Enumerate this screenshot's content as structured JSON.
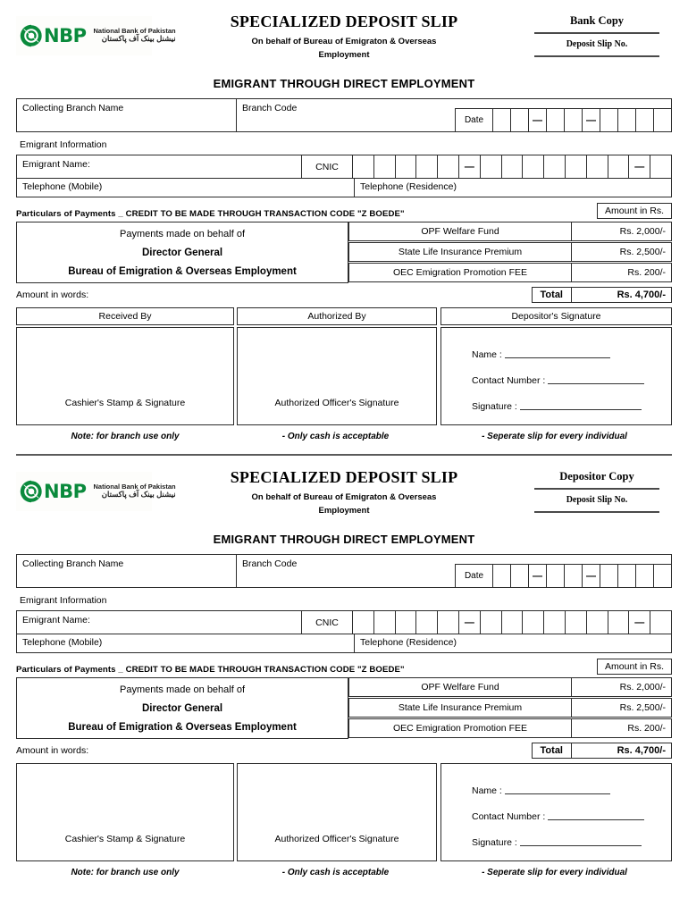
{
  "bank": {
    "logo_icon": "nbp-circular-logo-icon",
    "brand_short": "NBP",
    "name_en": "National Bank of Pakistan",
    "name_ur": "نیشنل بینک آف پاکستان",
    "brand_color": "#0a8a3c"
  },
  "title": "SPECIALIZED DEPOSIT SLIP",
  "subtitle_line1": "On behalf of Bureau of Emigraton  & Overseas",
  "subtitle_line2": "Employment",
  "banner": "EMIGRANT THROUGH DIRECT EMPLOYMENT",
  "deposit_slip_no_label": "Deposit Slip No.",
  "copies": [
    {
      "copy_label": "Bank Copy"
    },
    {
      "copy_label": "Depositor Copy"
    }
  ],
  "branch": {
    "collecting_branch_label": "Collecting Branch Name",
    "branch_code_label": "Branch Code",
    "date_label": "Date",
    "date_cells": [
      "",
      "",
      "—",
      "",
      "",
      "—",
      "",
      "",
      "",
      ""
    ]
  },
  "emigrant": {
    "section_label": "Emigrant Information",
    "name_label": "Emigrant Name:",
    "cnic_label": "CNIC",
    "cnic_cells": [
      "",
      "",
      "",
      "",
      "",
      "—",
      "",
      "",
      "",
      "",
      "",
      "",
      "",
      "—",
      ""
    ],
    "telephone_mobile_label": "Telephone (Mobile)",
    "telephone_residence_label": "Telephone (Residence)"
  },
  "particulars": {
    "label": "Particulars of Payments _ CREDIT TO BE MADE THROUGH TRANSACTION CODE \"Z BOEDE\"",
    "amount_header": "Amount in Rs.",
    "payer_line1": "Payments made on behalf of",
    "payer_line2": "Director General",
    "payer_line3": "Bureau of Emigration & Overseas Employment",
    "items": [
      {
        "description": "OPF Welfare Fund",
        "amount": "Rs. 2,000/-"
      },
      {
        "description": "State Life Insurance Premium",
        "amount": "Rs. 2,500/-"
      },
      {
        "description": "OEC Emigration Promotion FEE",
        "amount": "Rs. 200/-"
      }
    ],
    "amount_in_words_label": "Amount in words:",
    "total_label": "Total",
    "total_amount": "Rs. 4,700/-"
  },
  "signatures": {
    "headers": {
      "received_by": "Received By",
      "authorized_by": "Authorized By",
      "depositor_signature": "Depositor's Signature"
    },
    "cashier_caption": "Cashier's Stamp & Signature",
    "officer_caption": "Authorized Officer's Signature",
    "depositor_fields": {
      "name": "Name :",
      "contact_number": "Contact Number :",
      "signature": "Signature :"
    }
  },
  "notes": {
    "note1": "Note: for branch use only",
    "note2": "- Only cash is acceptable",
    "note3": "- Seperate slip for every individual"
  }
}
